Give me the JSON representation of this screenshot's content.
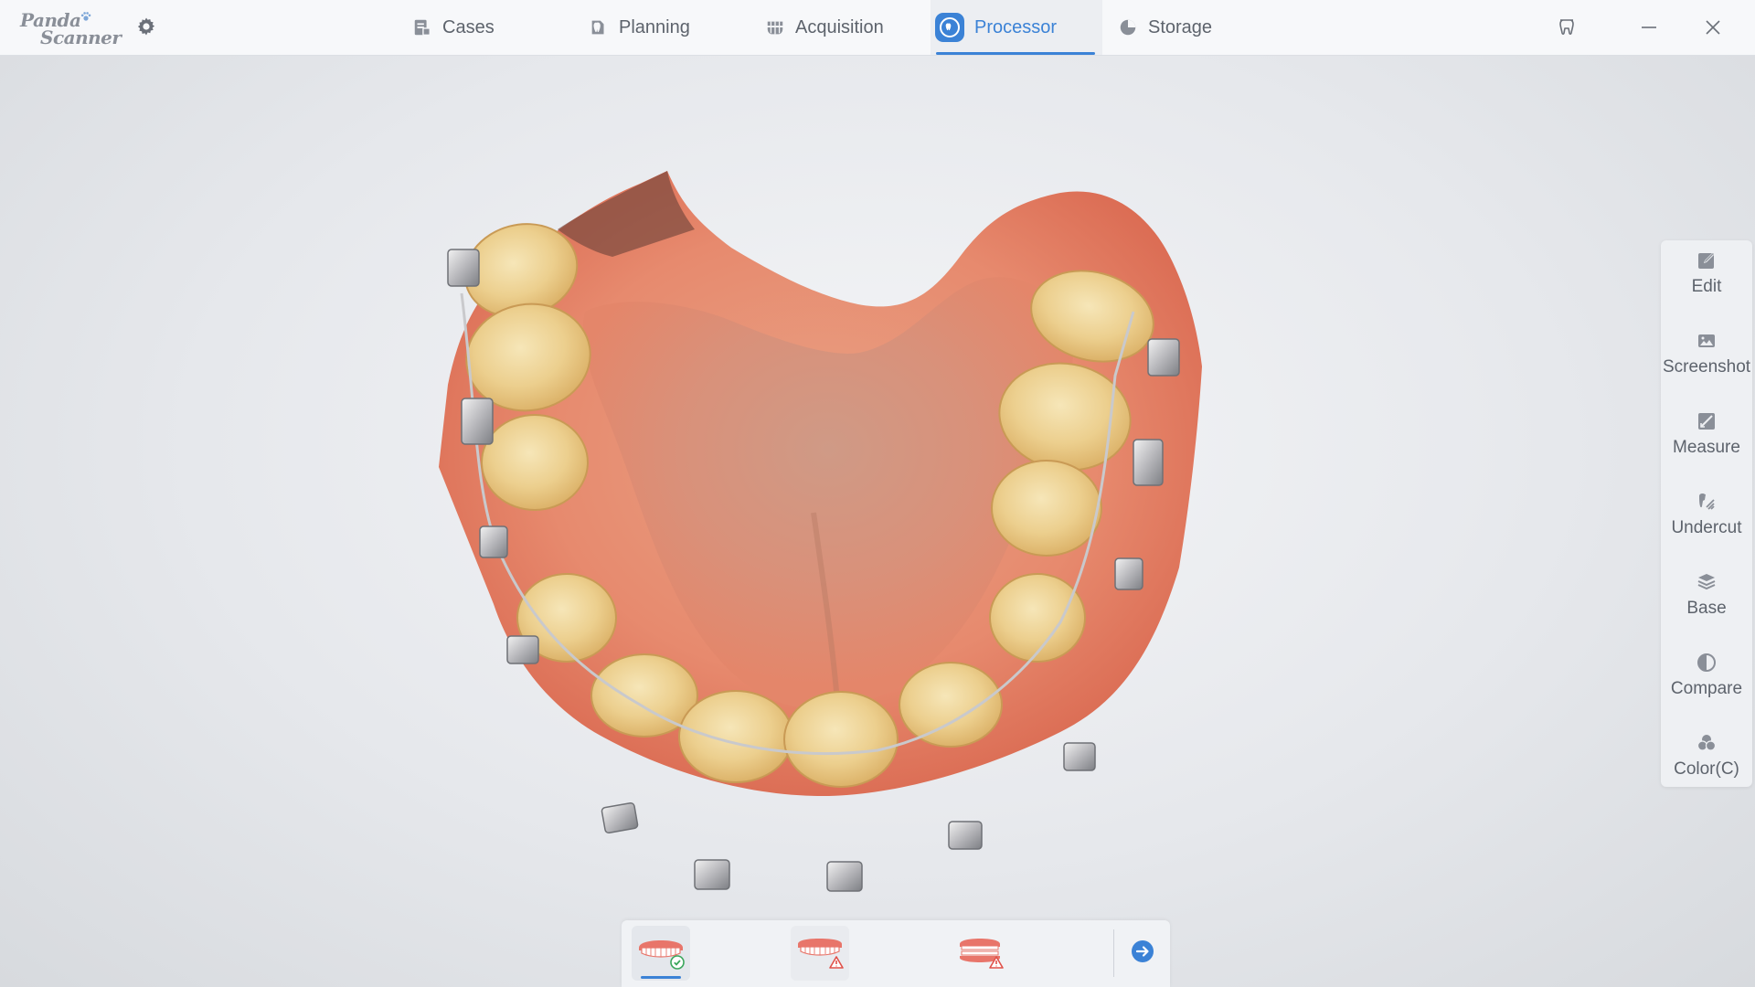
{
  "app": {
    "logo_line1": "Panda",
    "logo_line2": "Scanner"
  },
  "nav": {
    "tabs": [
      {
        "label": "Cases",
        "icon": "cases-icon"
      },
      {
        "label": "Planning",
        "icon": "planning-icon"
      },
      {
        "label": "Acquisition",
        "icon": "acquisition-icon"
      },
      {
        "label": "Processor",
        "icon": "processor-icon",
        "active": true
      },
      {
        "label": "Storage",
        "icon": "storage-icon"
      }
    ]
  },
  "tools": {
    "items": [
      {
        "label": "Edit",
        "icon": "edit-icon"
      },
      {
        "label": "Screenshot",
        "icon": "screenshot-icon"
      },
      {
        "label": "Measure",
        "icon": "measure-icon"
      },
      {
        "label": "Undercut",
        "icon": "undercut-icon"
      },
      {
        "label": "Base",
        "icon": "base-icon"
      },
      {
        "label": "Compare",
        "icon": "compare-icon"
      },
      {
        "label": "Color(C)",
        "icon": "color-icon"
      }
    ]
  },
  "bottom": {
    "jaws": [
      {
        "name": "upper-jaw",
        "status": "ok",
        "selected": true
      },
      {
        "name": "lower-jaw",
        "status": "warning"
      },
      {
        "name": "bite",
        "status": "warning"
      }
    ]
  },
  "colors": {
    "accent": "#3b82d6",
    "icon_gray": "#8a8f98",
    "ok": "#3aa65b",
    "warning": "#e0524a"
  }
}
